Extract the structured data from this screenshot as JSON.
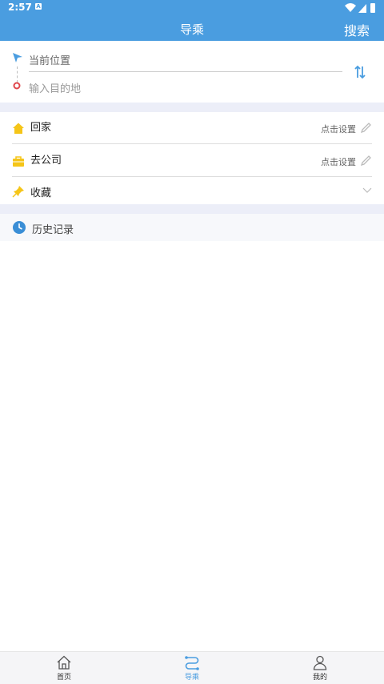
{
  "status": {
    "time": "2:57",
    "notification_badge": "A"
  },
  "header": {
    "title": "导乘",
    "search_label": "搜索"
  },
  "route": {
    "from_text": "当前位置",
    "to_placeholder": "输入目的地"
  },
  "shortcuts": {
    "home": {
      "label": "回家",
      "action": "点击设置"
    },
    "company": {
      "label": "去公司",
      "action": "点击设置"
    },
    "favorites": {
      "label": "收藏"
    }
  },
  "history": {
    "label": "历史记录"
  },
  "bottom_nav": {
    "items": [
      {
        "label": "首页",
        "icon": "home-icon",
        "active": false
      },
      {
        "label": "导乘",
        "icon": "route-icon",
        "active": true
      },
      {
        "label": "我的",
        "icon": "user-icon",
        "active": false
      }
    ]
  },
  "colors": {
    "brand_blue": "#4a9de0",
    "icon_yellow": "#f5c518",
    "destination_red": "#e0474c",
    "nav_inactive": "#666666"
  }
}
